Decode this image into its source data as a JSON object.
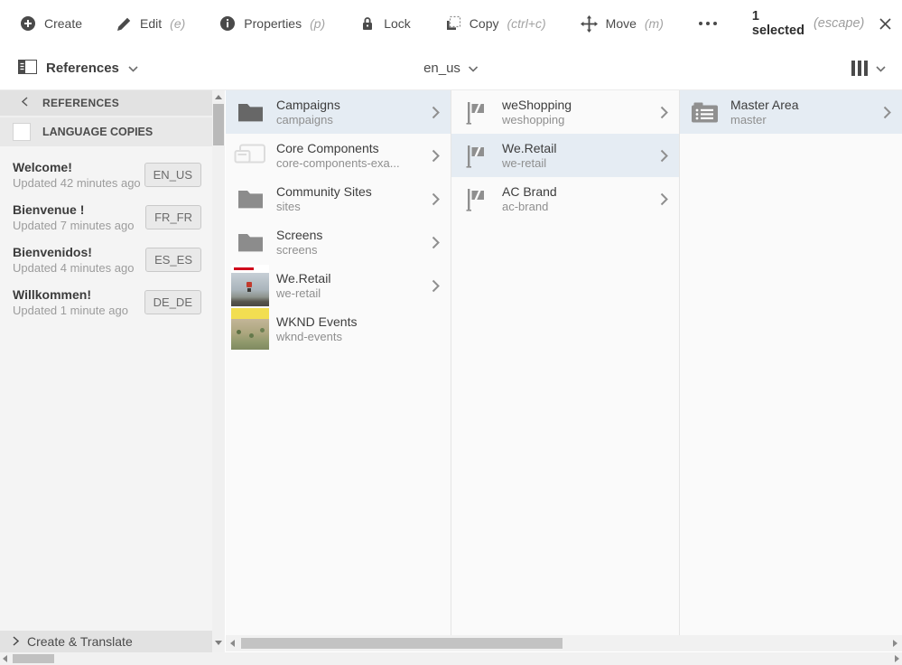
{
  "toolbar": {
    "items": [
      {
        "label": "Create",
        "shortcut": "",
        "icon": "plus-circle-icon"
      },
      {
        "label": "Edit",
        "shortcut": "(e)",
        "icon": "pencil-icon"
      },
      {
        "label": "Properties",
        "shortcut": "(p)",
        "icon": "info-circle-icon"
      },
      {
        "label": "Lock",
        "shortcut": "",
        "icon": "lock-icon"
      },
      {
        "label": "Copy",
        "shortcut": "(ctrl+c)",
        "icon": "copy-icon"
      },
      {
        "label": "Move",
        "shortcut": "(m)",
        "icon": "move-icon"
      }
    ],
    "more_icon": "ellipsis-icon",
    "selection": {
      "count": "1 selected",
      "hint": "(escape)",
      "close_icon": "close-icon"
    }
  },
  "nav": {
    "rail": {
      "label": "References",
      "icon": "rail-panel-icon"
    },
    "breadcrumb": {
      "label": "en_us"
    },
    "view": {
      "icon": "column-view-icon"
    }
  },
  "sidebar": {
    "header": {
      "title": "REFERENCES"
    },
    "section": {
      "title": "LANGUAGE COPIES",
      "checkbox_state": "unchecked"
    },
    "items": [
      {
        "title": "Welcome!",
        "updated": "Updated 42 minutes ago",
        "badge": "EN_US"
      },
      {
        "title": "Bienvenue !",
        "updated": "Updated 7 minutes ago",
        "badge": "FR_FR"
      },
      {
        "title": "Bienvenidos!",
        "updated": "Updated 4 minutes ago",
        "badge": "ES_ES"
      },
      {
        "title": "Willkommen!",
        "updated": "Updated 1 minute ago",
        "badge": "DE_DE"
      }
    ],
    "footer": {
      "title": "Create & Translate"
    }
  },
  "columns": [
    {
      "items": [
        {
          "title": "Campaigns",
          "path": "campaigns",
          "icon": "folder-dark-icon",
          "selected": true,
          "chevron": true
        },
        {
          "title": "Core Components",
          "path": "core-components-exa...",
          "icon": "components-icon",
          "selected": false,
          "chevron": true
        },
        {
          "title": "Community Sites",
          "path": "sites",
          "icon": "folder-icon",
          "selected": false,
          "chevron": true
        },
        {
          "title": "Screens",
          "path": "screens",
          "icon": "folder-icon",
          "selected": false,
          "chevron": true
        },
        {
          "title": "We.Retail",
          "path": "we-retail",
          "icon": "weretail-thumbnail",
          "selected": false,
          "chevron": true
        },
        {
          "title": "WKND Events",
          "path": "wknd-events",
          "icon": "wknd-thumbnail",
          "selected": false,
          "chevron": false
        }
      ]
    },
    {
      "items": [
        {
          "title": "weShopping",
          "path": "weshopping",
          "icon": "flag-icon",
          "selected": false,
          "chevron": true
        },
        {
          "title": "We.Retail",
          "path": "we-retail",
          "icon": "flag-icon",
          "selected": true,
          "chevron": true
        },
        {
          "title": "AC Brand",
          "path": "ac-brand",
          "icon": "flag-icon",
          "selected": false,
          "chevron": true
        }
      ]
    },
    {
      "items": [
        {
          "title": "Master Area",
          "path": "master",
          "icon": "blueprint-icon",
          "selected": true,
          "chevron": true
        }
      ]
    }
  ],
  "colors": {
    "selected_row": "#e5ecf3",
    "toolbar_icon": "#4a4a4a",
    "badge_bg": "#e9e9e9",
    "sidebar_bg": "#f4f4f4",
    "header_strip": "#e2e2e2"
  }
}
